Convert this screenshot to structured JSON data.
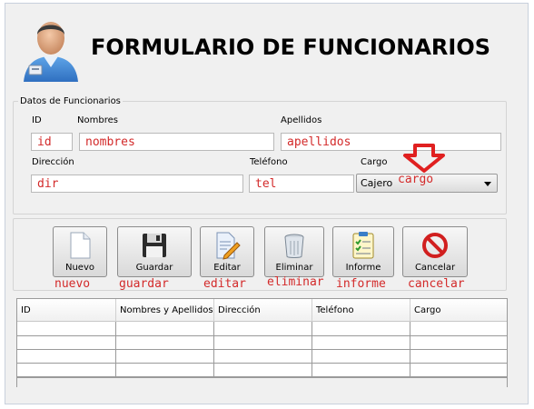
{
  "title": "FORMULARIO DE FUNCIONARIOS",
  "group": {
    "title": "Datos de Funcionarios",
    "labels": {
      "id": "ID",
      "nombres": "Nombres",
      "apellidos": "Apellidos",
      "direccion": "Dirección",
      "telefono": "Teléfono",
      "cargo": "Cargo"
    },
    "fields": {
      "id": "id",
      "nombres": "nombres",
      "apellidos": "apellidos",
      "direccion": "dir",
      "telefono": "tel"
    },
    "cargo": {
      "selected": "Cajero",
      "annotation": "cargo"
    }
  },
  "buttons": [
    {
      "label": "Nuevo",
      "annotation": "nuevo",
      "icon": "blank-document-icon"
    },
    {
      "label": "Guardar",
      "annotation": "guardar",
      "icon": "floppy-disk-icon"
    },
    {
      "label": "Editar",
      "annotation": "editar",
      "icon": "edit-document-icon"
    },
    {
      "label": "Eliminar",
      "annotation": "eliminar",
      "icon": "trash-can-icon"
    },
    {
      "label": "Informe",
      "annotation": "informe",
      "icon": "checklist-report-icon"
    },
    {
      "label": "Cancelar",
      "annotation": "cancelar",
      "icon": "cancel-circle-icon"
    }
  ],
  "table": {
    "columns": [
      "ID",
      "Nombres y Apellidos",
      "Dirección",
      "Teléfono",
      "Cargo"
    ],
    "rows": [
      [
        "",
        "",
        "",
        "",
        ""
      ],
      [
        "",
        "",
        "",
        "",
        ""
      ],
      [
        "",
        "",
        "",
        "",
        ""
      ],
      [
        "",
        "",
        "",
        "",
        ""
      ]
    ]
  },
  "colors": {
    "annotation": "#d32a2a",
    "window_bg": "#f0f0f0"
  }
}
